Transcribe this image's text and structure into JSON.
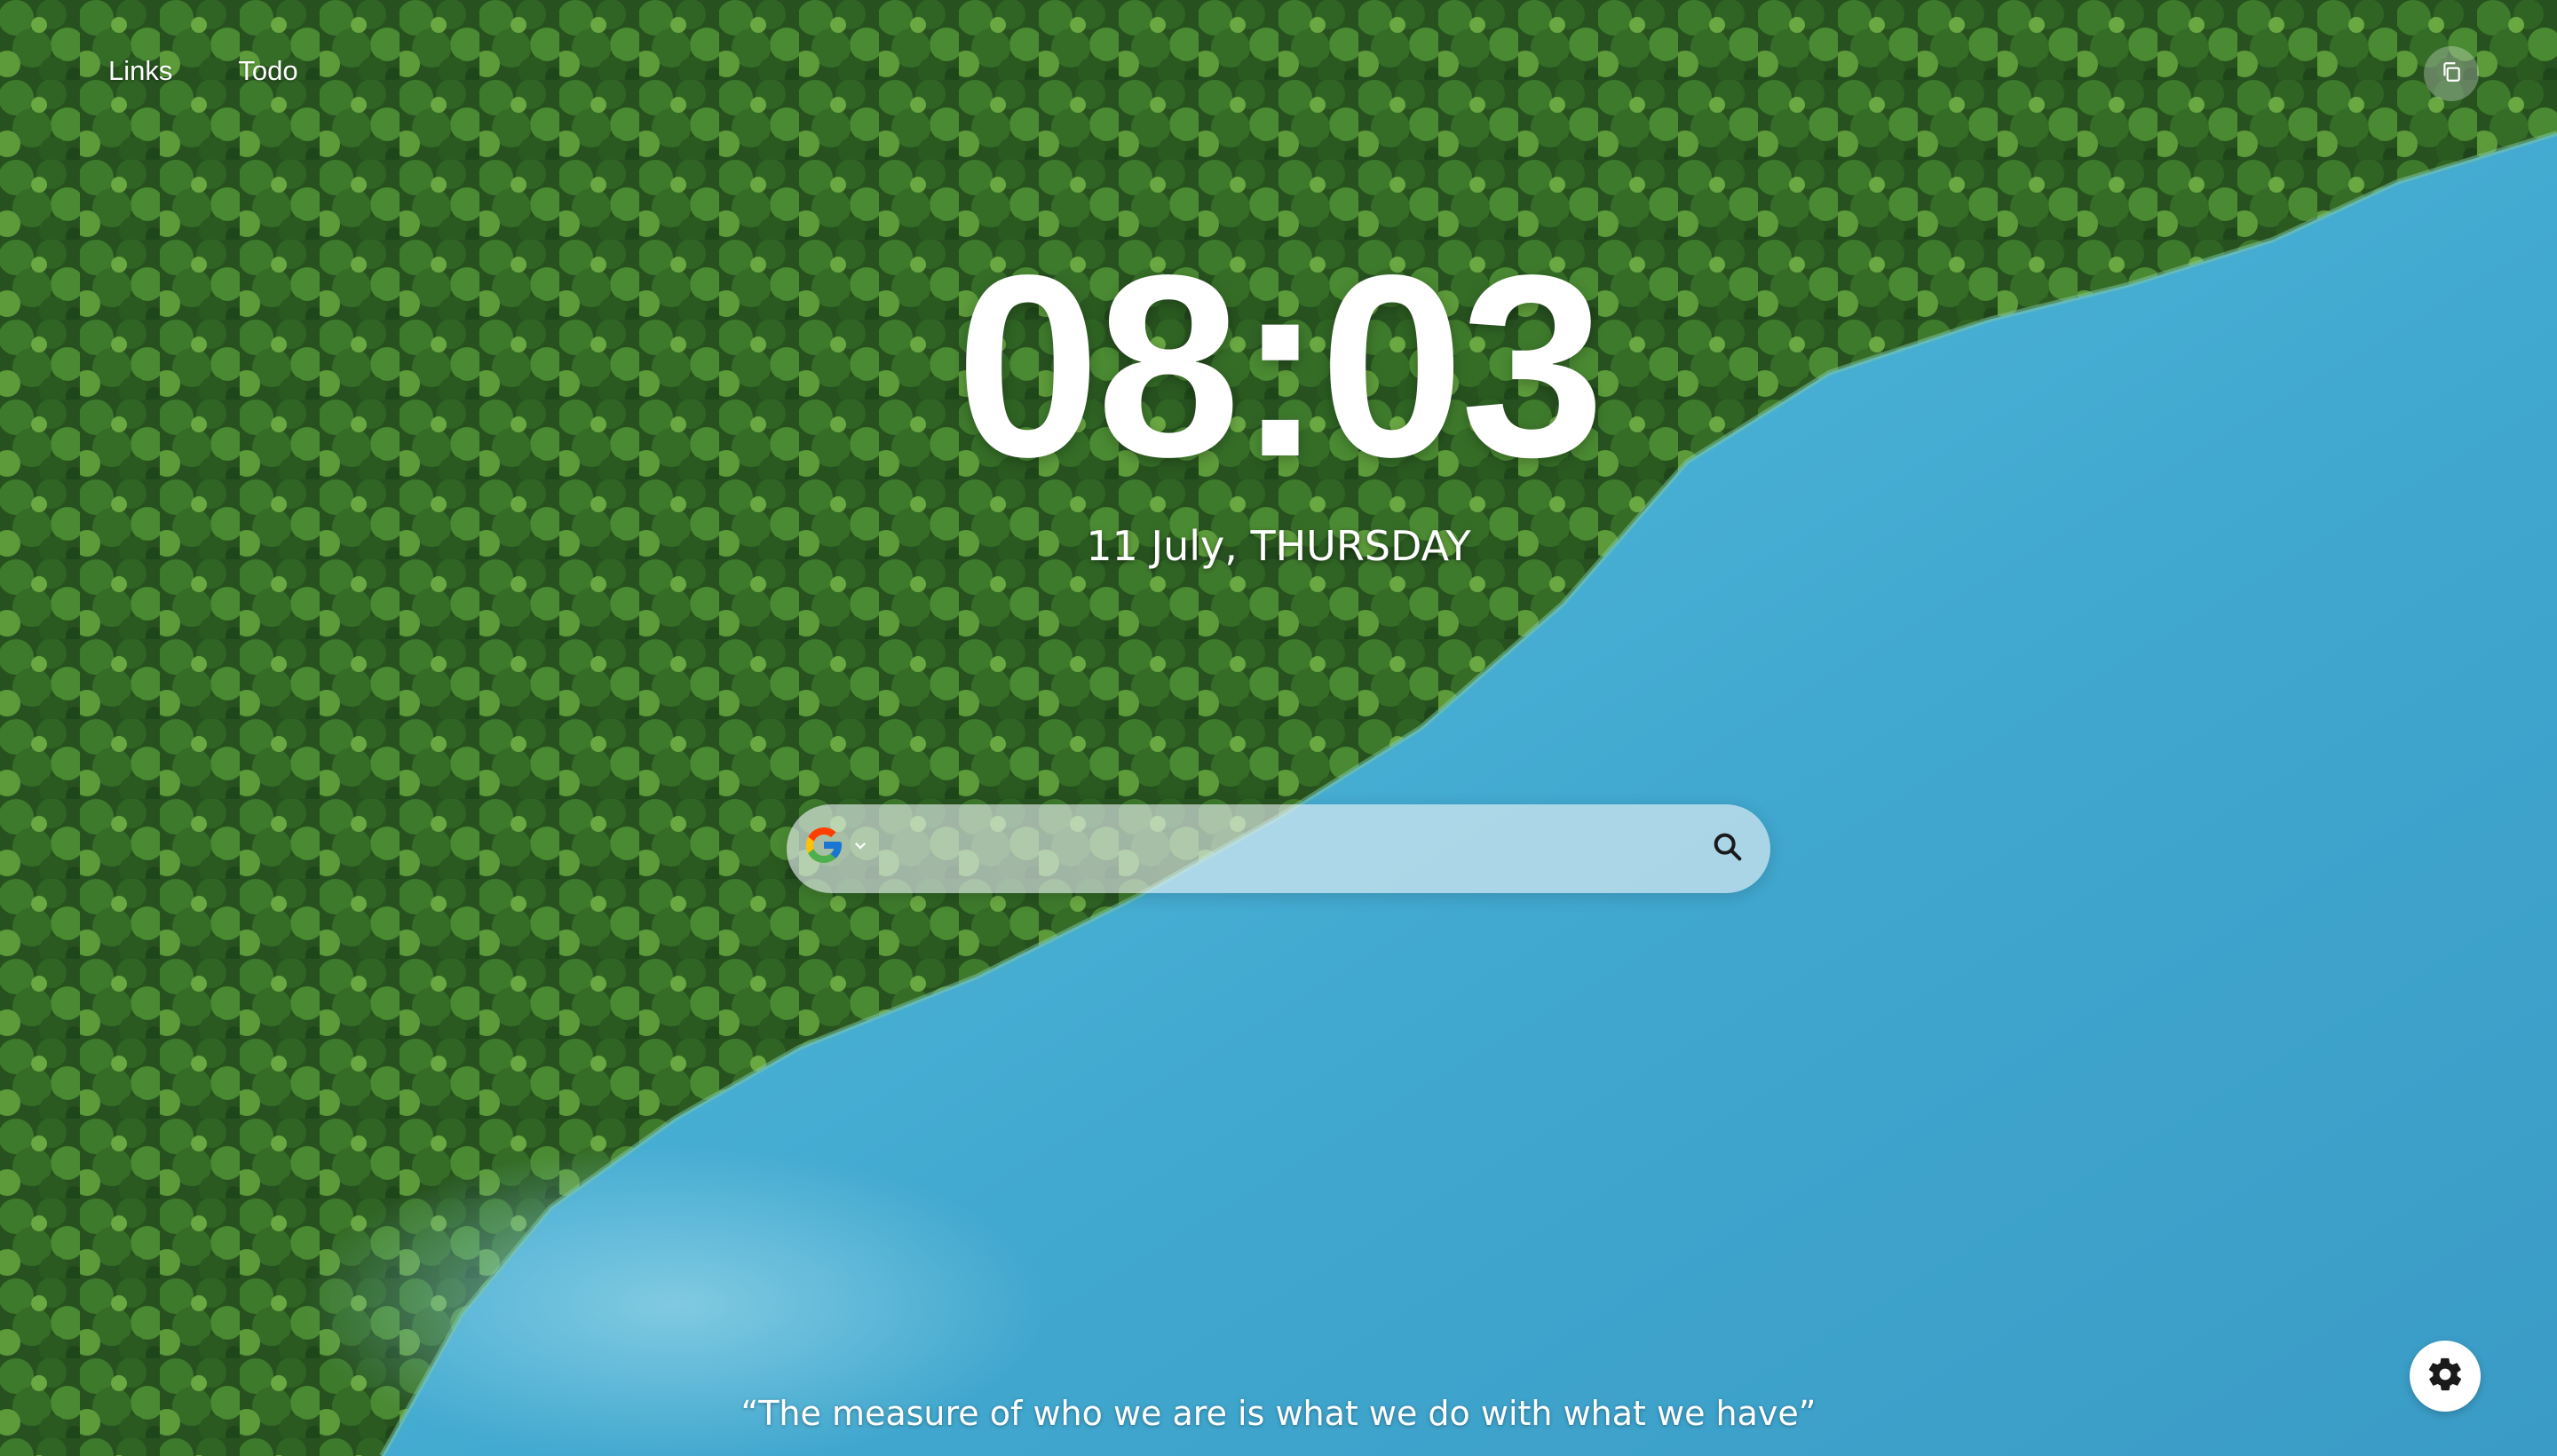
{
  "nav": {
    "links_label": "Links",
    "todo_label": "Todo"
  },
  "clock": {
    "time": "08:03",
    "date": "11 July, THURSDAY"
  },
  "search": {
    "engine_icon": "google-icon",
    "placeholder": "",
    "value": ""
  },
  "quote": {
    "text": "“The measure of who we are is what we do with what we have”"
  },
  "icons": {
    "copy": "copy-icon",
    "search": "search-icon",
    "settings": "gear-icon"
  },
  "colors": {
    "forest": "#2f5a24",
    "lake": "#49acd2",
    "white": "#ffffff"
  }
}
